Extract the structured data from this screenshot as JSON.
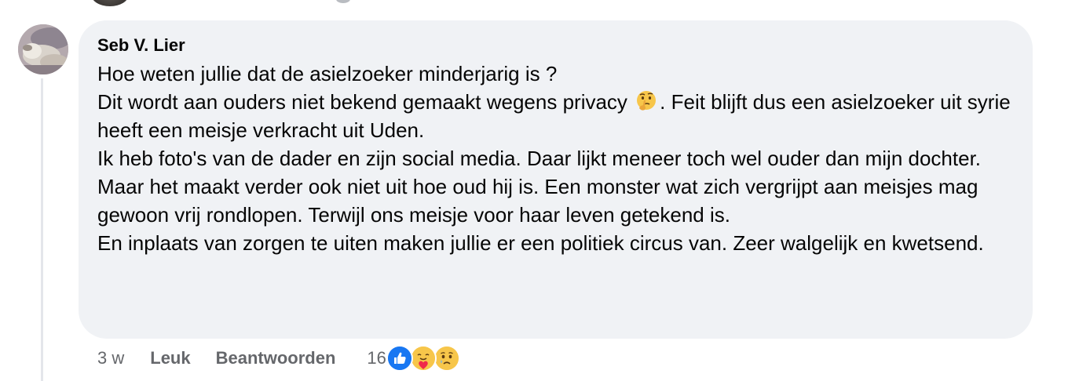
{
  "comment": {
    "author": "Seb V. Lier",
    "avatar_icon": "user-avatar-photo",
    "lines": [
      {
        "before": "Hoe weten jullie dat de asielzoeker minderjarig is ?"
      },
      {
        "before": "Dit wordt aan ouders niet bekend gemaakt wegens privacy ",
        "emoji": "thinking-face-icon",
        "after": ". Feit blijft dus een asielzoeker uit syrie heeft een meisje verkracht uit Uden."
      },
      {
        "before": "Ik heb foto's van de dader en zijn social media. Daar lijkt meneer toch wel ouder dan mijn dochter."
      },
      {
        "before": "Maar het maakt verder ook niet uit hoe oud hij is. Een monster wat zich vergrijpt aan meisjes mag gewoon vrij rondlopen. Terwijl ons meisje voor haar leven getekend is."
      },
      {
        "before": "En inplaats van zorgen te uiten maken jullie er een politiek circus van. Zeer walgelijk en kwetsend."
      }
    ]
  },
  "actions": {
    "time": "3 w",
    "like_label": "Leuk",
    "reply_label": "Beantwoorden",
    "reaction_count": "16",
    "reaction_icons": [
      "like-reaction-icon",
      "care-reaction-icon",
      "sad-reaction-icon"
    ]
  },
  "colors": {
    "bubble": "#f0f2f5",
    "text": "#050505",
    "secondary": "#65676b",
    "like_blue": "#1877f2"
  }
}
